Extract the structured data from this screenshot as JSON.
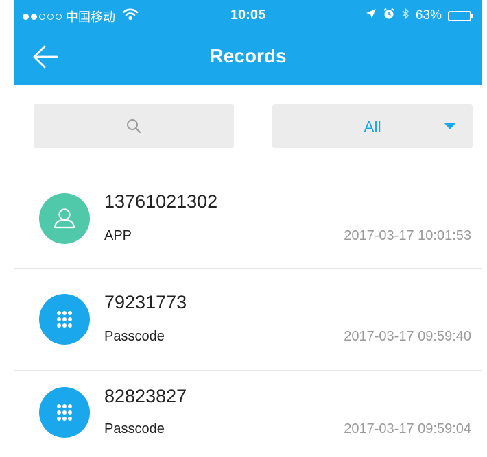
{
  "status_bar": {
    "carrier": "中国移动",
    "time": "10:05",
    "battery": "63%",
    "battery_level": 0.63,
    "signal_bars_filled": 2,
    "signal_bars_total": 5
  },
  "nav": {
    "title": "Records",
    "back_icon": "arrow-left-icon"
  },
  "filters": {
    "search_placeholder": "",
    "search_icon": "search-icon",
    "type_selected": "All"
  },
  "colors": {
    "accent": "#1aa7ec",
    "app_avatar": "#4fc9a9",
    "passcode_avatar": "#1aa7ec",
    "time_text": "#9a9a9a"
  },
  "records": [
    {
      "number": "13761021302",
      "type": "APP",
      "time": "2017-03-17 10:01:53",
      "icon": "user-icon"
    },
    {
      "number": "79231773",
      "type": "Passcode",
      "time": "2017-03-17 09:59:40",
      "icon": "keypad-icon"
    },
    {
      "number": "82823827",
      "type": "Passcode",
      "time": "2017-03-17 09:59:04",
      "icon": "keypad-icon"
    }
  ]
}
